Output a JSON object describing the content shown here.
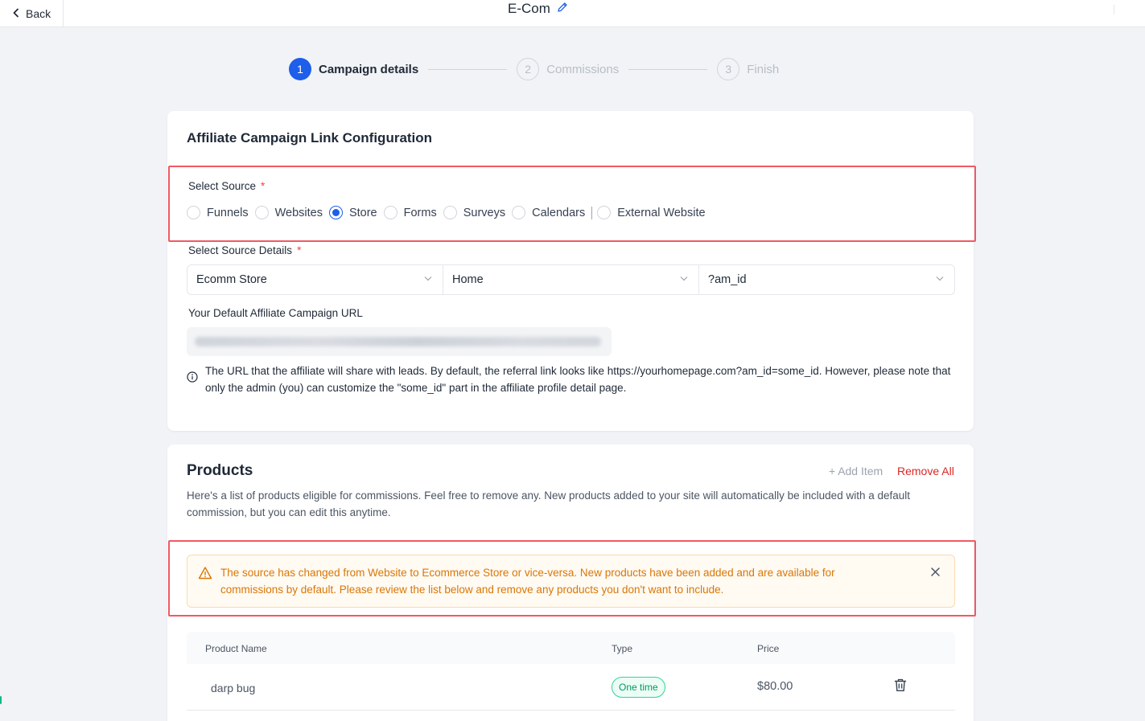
{
  "topbar": {
    "back_label": "Back",
    "title": "E-Com"
  },
  "stepper": {
    "steps": [
      {
        "num": "1",
        "label": "Campaign details",
        "state": "active"
      },
      {
        "num": "2",
        "label": "Commissions",
        "state": "inactive"
      },
      {
        "num": "3",
        "label": "Finish",
        "state": "inactive"
      }
    ]
  },
  "link_config": {
    "title": "Affiliate Campaign Link Configuration",
    "source_label": "Select Source",
    "required_mark": "*",
    "sources": [
      {
        "label": "Funnels",
        "checked": false
      },
      {
        "label": "Websites",
        "checked": false
      },
      {
        "label": "Store",
        "checked": true
      },
      {
        "label": "Forms",
        "checked": false
      },
      {
        "label": "Surveys",
        "checked": false
      },
      {
        "label": "Calendars",
        "checked": false
      },
      {
        "label": "External Website",
        "checked": false
      }
    ],
    "source_details_label": "Select Source Details",
    "selects": [
      "Ecomm Store",
      "Home",
      "?am_id"
    ],
    "url_label": "Your Default Affiliate Campaign URL",
    "info_text": "The URL that the affiliate will share with leads. By default, the referral link looks like https://yourhomepage.com?am_id=some_id. However, please note that only the admin (you) can customize the \"some_id\" part in the affiliate profile detail page."
  },
  "products": {
    "title": "Products",
    "add_item_label": "Add Item",
    "remove_all_label": "Remove All",
    "description": "Here's a list of products eligible for commissions. Feel free to remove any. New products added to your site will automatically be included with a default commission, but you can edit this anytime.",
    "alert_text": "The source has changed from Website to Ecommerce Store or vice-versa. New products have been added and are available for commissions by default. Please review the list below and remove any products you don't want to include.",
    "columns": [
      "Product Name",
      "Type",
      "Price"
    ],
    "rows": [
      {
        "name": "darp bug",
        "type": "One time",
        "price": "$80.00"
      }
    ]
  },
  "colors": {
    "accent": "#1d5eea",
    "highlight": "#ef5a63",
    "warning": "#d97706",
    "danger": "#dc2626",
    "success": "#059669"
  }
}
